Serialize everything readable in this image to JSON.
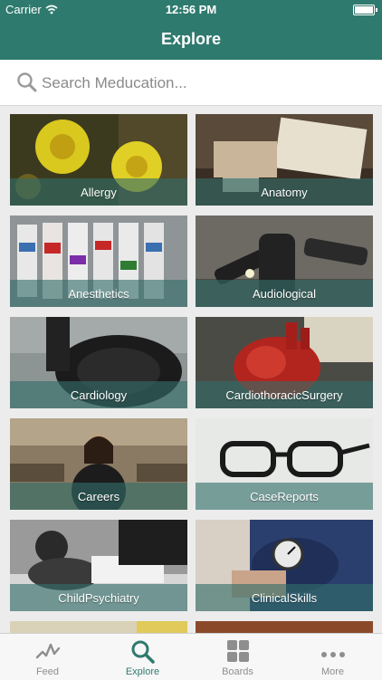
{
  "status_bar": {
    "carrier": "Carrier",
    "time": "12:56 PM"
  },
  "nav": {
    "title": "Explore"
  },
  "search": {
    "placeholder": "Search Meducation..."
  },
  "topics": [
    {
      "label": "Allergy"
    },
    {
      "label": "Anatomy"
    },
    {
      "label": "Anesthetics"
    },
    {
      "label": "Audiological"
    },
    {
      "label": "Cardiology"
    },
    {
      "label": "CardiothoracicSurgery"
    },
    {
      "label": "Careers"
    },
    {
      "label": "CaseReports"
    },
    {
      "label": "ChildPsychiatry"
    },
    {
      "label": "ClinicalSkills"
    }
  ],
  "tab_bar": {
    "items": [
      {
        "label": "Feed",
        "icon": "feed-icon"
      },
      {
        "label": "Explore",
        "icon": "search-icon",
        "active": true
      },
      {
        "label": "Boards",
        "icon": "boards-icon"
      },
      {
        "label": "More",
        "icon": "more-icon"
      }
    ]
  },
  "colors": {
    "brand": "#2f7a6e",
    "band": "#326e69"
  }
}
